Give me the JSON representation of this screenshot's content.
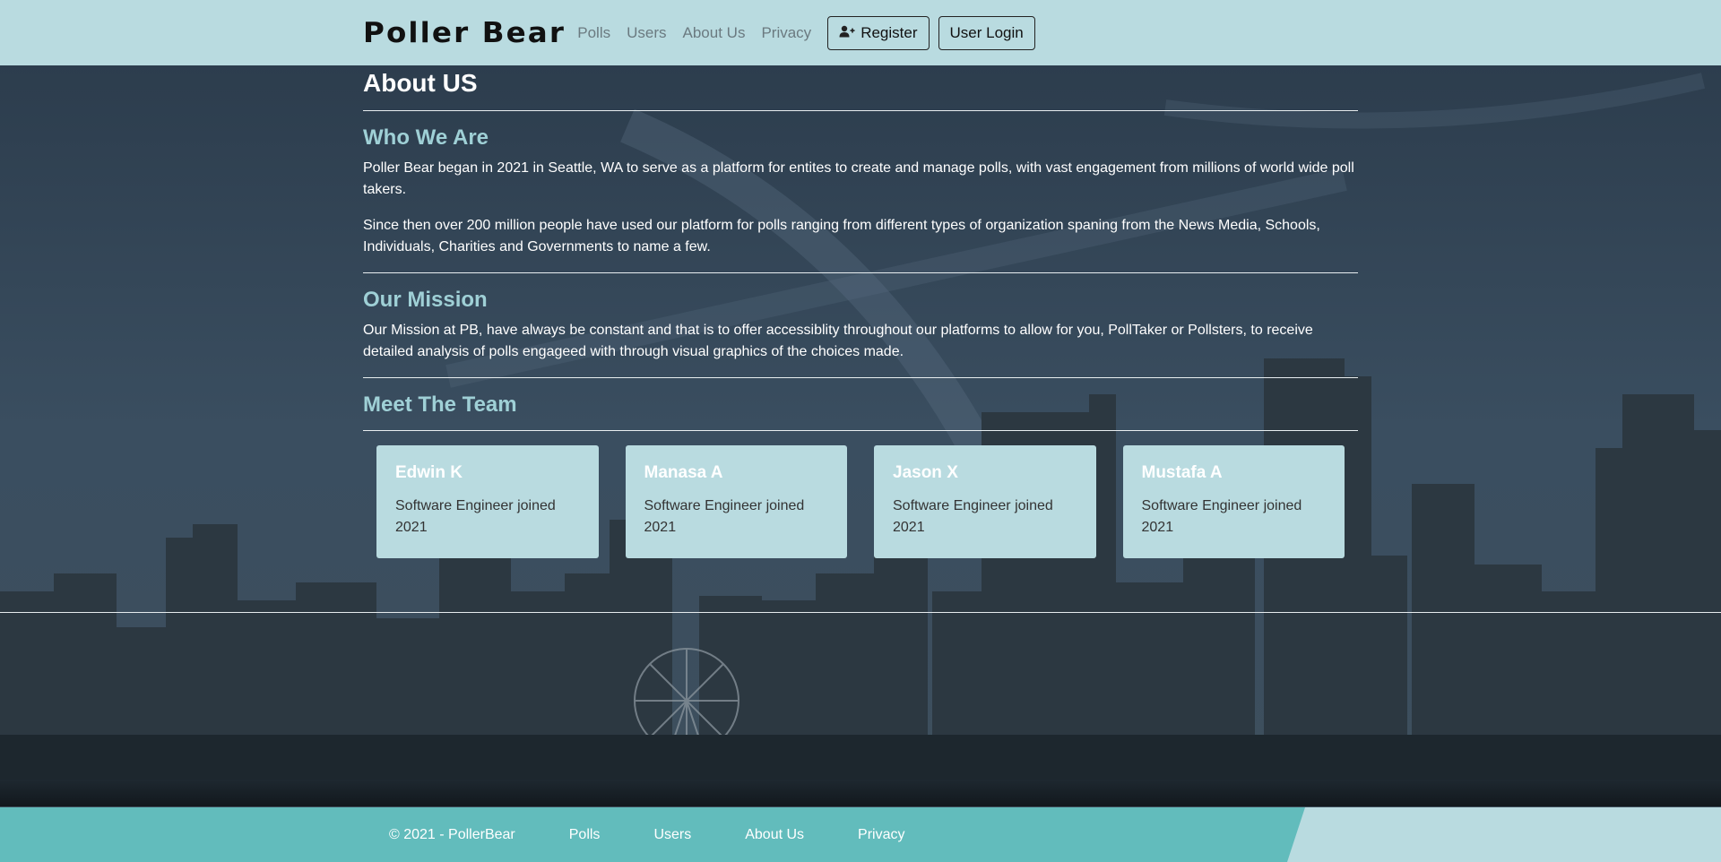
{
  "nav": {
    "brand": "Poller Bear",
    "links": [
      "Polls",
      "Users",
      "About Us",
      "Privacy"
    ],
    "register_label": "Register",
    "register_icon": "user-plus-icon",
    "login_label": "User Login"
  },
  "page": {
    "title": "About US"
  },
  "sections": {
    "who": {
      "title": "Who We Are",
      "p1": "Poller Bear began in 2021 in Seattle, WA to serve as a platform for entites to create and manage polls, with vast engagement from millions of world wide poll takers.",
      "p2": "Since then over 200 million people have used our platform for polls ranging from different types of organization spaning from the News Media, Schools, Individuals, Charities and Governments to name a few."
    },
    "mission": {
      "title": "Our Mission",
      "p1": "Our Mission at PB, have always be constant and that is to offer accessiblity throughout our platforms to allow for you, PollTaker or Pollsters, to receive detailed analysis of polls engageed with through visual graphics of the choices made."
    },
    "team": {
      "title": "Meet The Team",
      "members": [
        {
          "name": "Edwin K",
          "role": "Software Engineer joined 2021"
        },
        {
          "name": "Manasa A",
          "role": "Software Engineer joined 2021"
        },
        {
          "name": "Jason X",
          "role": "Software Engineer joined 2021"
        },
        {
          "name": "Mustafa A",
          "role": "Software Engineer joined 2021"
        }
      ]
    }
  },
  "footer": {
    "copyright": "© 2021 - PollerBear",
    "links": [
      "Polls",
      "Users",
      "About Us",
      "Privacy"
    ]
  },
  "colors": {
    "navbar": "#b9dbe0",
    "accent_heading": "#9fd0d6",
    "footer_dark": "#62bcbc",
    "footer_light": "#b9dbe0"
  }
}
